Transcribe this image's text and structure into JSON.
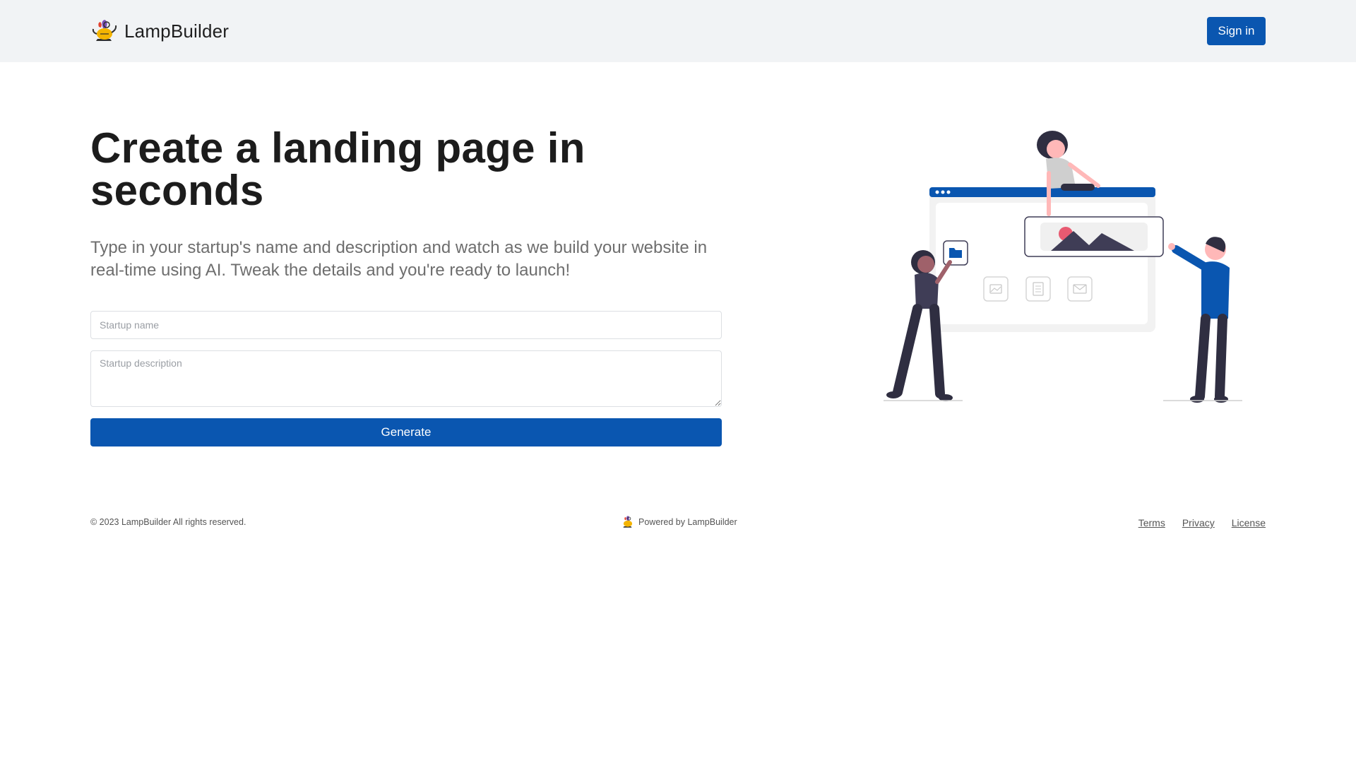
{
  "header": {
    "brand_name": "LampBuilder",
    "sign_in_label": "Sign in",
    "accent_color": "#0a56b0",
    "background_color": "#f1f3f5"
  },
  "hero": {
    "title": "Create a landing page in seconds",
    "subtitle": "Type in your startup's name and description and watch as we build your website in real-time using AI. Tweak the details and you're ready to launch!"
  },
  "form": {
    "name_placeholder": "Startup name",
    "name_value": "",
    "description_placeholder": "Startup description",
    "description_value": "",
    "generate_label": "Generate"
  },
  "illustration": {
    "icons": [
      "folder-icon",
      "image-icon",
      "document-icon",
      "mail-icon"
    ]
  },
  "footer": {
    "copyright": "© 2023 LampBuilder All rights reserved.",
    "powered_by": "Powered by LampBuilder",
    "links": [
      "Terms",
      "Privacy",
      "License"
    ]
  }
}
